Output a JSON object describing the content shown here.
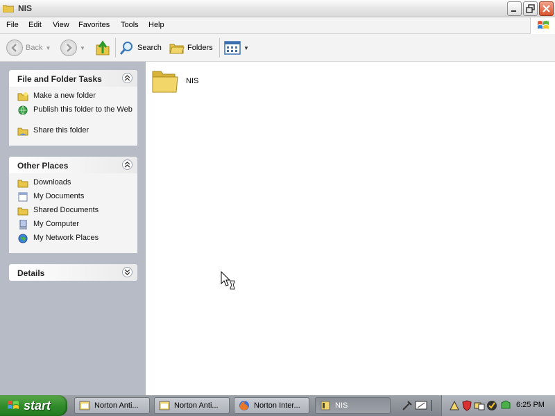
{
  "window": {
    "title": "NIS"
  },
  "menu": [
    "File",
    "Edit",
    "View",
    "Favorites",
    "Tools",
    "Help"
  ],
  "toolbar": {
    "back": "Back",
    "search": "Search",
    "folders": "Folders"
  },
  "taskpane": {
    "file_tasks": {
      "title": "File and Folder Tasks",
      "items": [
        "Make a new folder",
        "Publish this folder to the Web",
        "Share this folder"
      ]
    },
    "other_places": {
      "title": "Other Places",
      "items": [
        "Downloads",
        "My Documents",
        "Shared Documents",
        "My Computer",
        "My Network Places"
      ]
    },
    "details": {
      "title": "Details"
    }
  },
  "content": {
    "items": [
      {
        "name": "NIS",
        "icon": "folder-icon"
      }
    ]
  },
  "taskbar": {
    "start": "start",
    "buttons": [
      "Norton Anti...",
      "Norton Anti...",
      "Norton Inter...",
      "NIS"
    ],
    "active_button": "NIS",
    "clock": "6:25 PM"
  },
  "colors": {
    "taskpane_bg": "#b7bbc6",
    "start_green": "#2f8b2a",
    "close_red": "#d8532f"
  }
}
